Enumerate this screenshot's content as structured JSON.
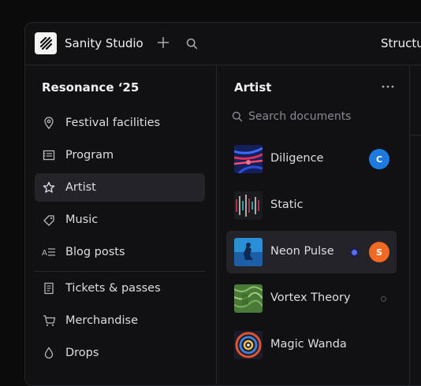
{
  "header": {
    "app_title": "Sanity Studio",
    "tool_tab": "Structure",
    "icons": [
      "sanity-logo-icon",
      "plus-icon",
      "search-icon"
    ]
  },
  "nav": {
    "title": "Resonance ‘25",
    "items": [
      {
        "label": "Festival facilities",
        "icon": "pin-icon",
        "active": false
      },
      {
        "label": "Program",
        "icon": "list-icon",
        "active": false
      },
      {
        "label": "Artist",
        "icon": "star-icon",
        "active": true
      },
      {
        "label": "Music",
        "icon": "tag-icon",
        "active": false
      },
      {
        "label": "Blog posts",
        "icon": "text-icon",
        "active": false
      },
      {
        "label": "Tickets & passes",
        "icon": "document-icon",
        "active": false
      },
      {
        "label": "Merchandise",
        "icon": "cart-icon",
        "active": false
      },
      {
        "label": "Drops",
        "icon": "drop-icon",
        "active": false
      }
    ]
  },
  "docs": {
    "title": "Artist",
    "search_placeholder": "Search documents",
    "items": [
      {
        "name": "Diligence",
        "avatar": "C",
        "avatar_color": "#1f7ae0",
        "active": false
      },
      {
        "name": "Static",
        "avatar": "",
        "active": false
      },
      {
        "name": "Neon Pulse",
        "avatar": "S",
        "avatar_color": "#f06a24",
        "status": "edited",
        "active": true
      },
      {
        "name": "Vortex Theory",
        "avatar": "",
        "status": "draft",
        "active": false
      },
      {
        "name": "Magic Wanda",
        "avatar": "",
        "active": false
      }
    ]
  },
  "colors": {
    "accent_blue": "#1f7ae0",
    "accent_orange": "#f06a24",
    "status_blue": "#5a6cff"
  }
}
